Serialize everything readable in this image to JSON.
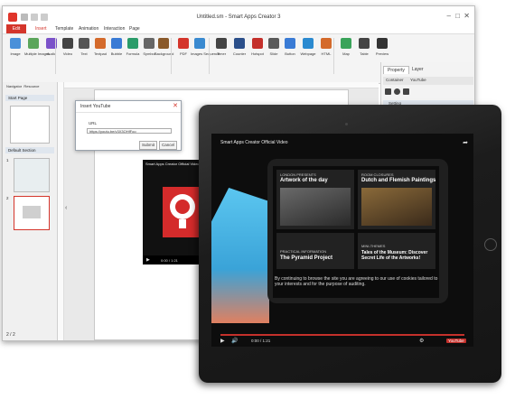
{
  "window": {
    "title": "Untitled.sm - Smart Apps Creator 3",
    "minimize": "–",
    "maximize": "□",
    "close": "✕"
  },
  "menu_tabs": [
    "Edit",
    "Insert",
    "Template",
    "Animation",
    "Interaction",
    "Page"
  ],
  "active_tab": "Insert",
  "ribbon": [
    {
      "label": "Image",
      "icon": "image-icon",
      "color": "#4a90d9"
    },
    {
      "label": "Multiple Images",
      "icon": "multiple-images-icon",
      "color": "#5ba55b"
    },
    {
      "label": "Audio",
      "icon": "audio-icon",
      "color": "#7b52c9"
    },
    {
      "label": "Video",
      "icon": "video-icon",
      "color": "#444444"
    },
    {
      "label": "Text",
      "icon": "text-icon",
      "color": "#555555"
    },
    {
      "label": "Textpad",
      "icon": "textpad-icon",
      "color": "#d46a2b"
    },
    {
      "label": "Bubble",
      "icon": "bubble-icon",
      "color": "#3a7bd5"
    },
    {
      "label": "Formula",
      "icon": "formula-icon",
      "color": "#2b9c6a"
    },
    {
      "label": "Symbol",
      "icon": "symbol-icon",
      "color": "#666666"
    },
    {
      "label": "Background",
      "icon": "background-icon",
      "color": "#8a5a2b"
    },
    {
      "label": "PDF",
      "icon": "pdf-icon",
      "color": "#d4352b"
    },
    {
      "label": "Images Sequence",
      "icon": "images-sequence-icon",
      "color": "#3a8ad0"
    },
    {
      "label": "Timer",
      "icon": "timer-icon",
      "color": "#444444"
    },
    {
      "label": "Counter",
      "icon": "counter-icon",
      "color": "#2b4f8a"
    },
    {
      "label": "Hotspot",
      "icon": "hotspot-icon",
      "color": "#c4302b"
    },
    {
      "label": "Slide",
      "icon": "slide-icon",
      "color": "#5a5a5a"
    },
    {
      "label": "Button",
      "icon": "button-icon",
      "color": "#3a7bd5"
    },
    {
      "label": "Webpage",
      "icon": "webpage-icon",
      "color": "#2b8ad0"
    },
    {
      "label": "HTML",
      "icon": "html-icon",
      "color": "#d46a2b"
    },
    {
      "label": "Map",
      "icon": "map-icon",
      "color": "#3aa35a"
    },
    {
      "label": "Table",
      "icon": "table-icon",
      "color": "#444444"
    },
    {
      "label": "Preview",
      "icon": "preview-icon",
      "color": "#333333"
    }
  ],
  "left_panel": {
    "tabs": [
      "Navigator",
      "Resource"
    ],
    "start_page": "Start Page",
    "section": "Default Section",
    "pages": [
      "1",
      "2"
    ],
    "footer": "2 / 2"
  },
  "right_panel": {
    "tabs": [
      "Property",
      "Layer"
    ],
    "sub_tabs": [
      "Container",
      "YouTube"
    ],
    "section": "Setting"
  },
  "dialog": {
    "title": "Insert YouTube",
    "url_label": "URL",
    "url_value": "https://youtu.be/v3X3OHfFoo",
    "submit": "Submit",
    "cancel": "Cancel"
  },
  "embedded_video": {
    "title": "Smart Apps Creator Official Video",
    "time": "0:00 / 1:21"
  },
  "tablet_video": {
    "title": "Smart Apps Creator Official Video",
    "panes": [
      {
        "label": "LONDON PRESENTS",
        "title": "Artwork of the day"
      },
      {
        "label": "ROOM CLOSURES",
        "title": "Dutch and Flemish Paintings"
      },
      {
        "label": "PRACTICAL INFORMATION",
        "title": "The Pyramid Project"
      },
      {
        "label": "MINI-THEMES",
        "title": "Tales of the Museum: Discover Secret Life of the Artworks!"
      }
    ],
    "overlay": "By continuing to browse the site you are agreeing to our use of cookies tailored to your interests and for the purpose of auditing.",
    "time": "0:00 / 1:21",
    "logo": "YouTube"
  }
}
